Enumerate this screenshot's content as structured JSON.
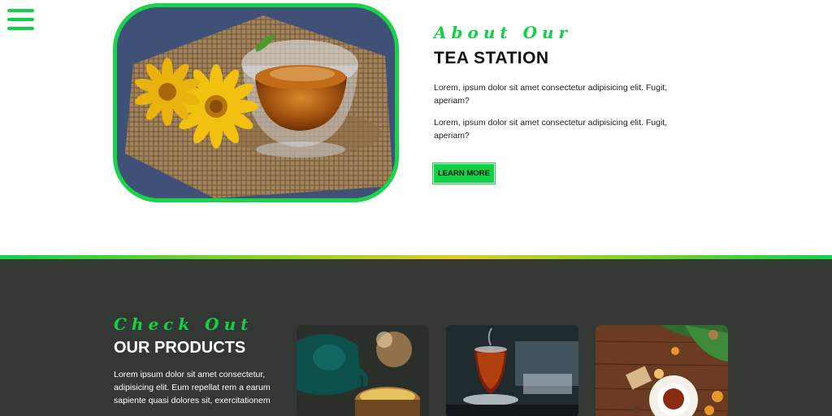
{
  "about": {
    "subheading": "About Our",
    "title": "TEA STATION",
    "paragraph_1": "Lorem, ipsum dolor sit amet consectetur adipisicing elit. Fugit, aperiam?",
    "paragraph_2": "Lorem, ipsum dolor sit amet consectetur adipisicing elit. Fugit, aperiam?",
    "button_label": "LEARN MORE"
  },
  "products": {
    "subheading": "Check Out",
    "title": "OUR PRODUCTS",
    "paragraph": "Lorem ipsum dolor sit amet consectetur, adipisicing elit. Eum repellat rem a earum sapiente quasi dolores sit, exercitationem"
  },
  "colors": {
    "accent": "#13d146",
    "dark_section": "#333834"
  },
  "icons": {
    "menu": "hamburger-menu-icon"
  }
}
